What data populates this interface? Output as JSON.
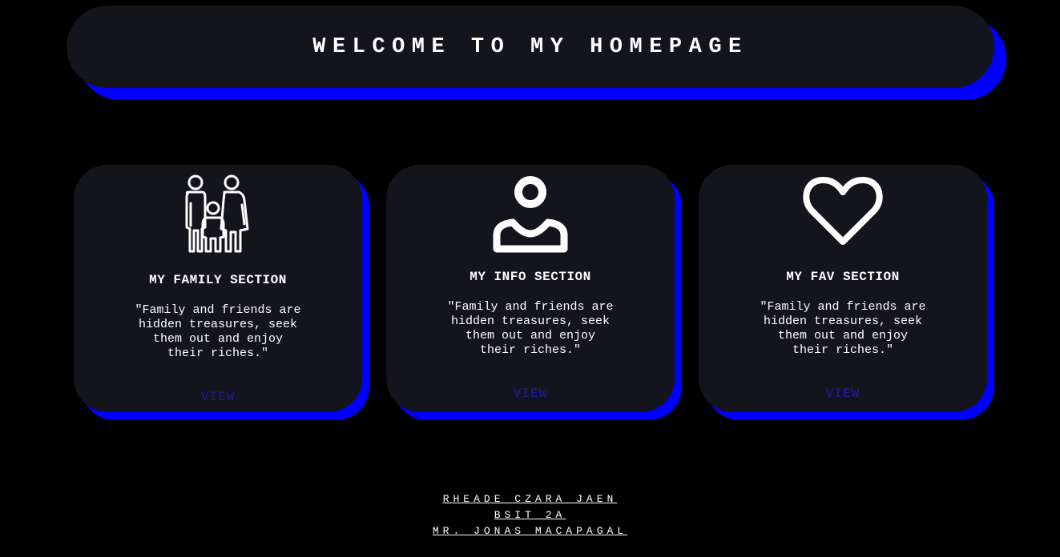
{
  "header": {
    "title": "WELCOME TO MY HOMEPAGE"
  },
  "cards": [
    {
      "icon": "family-icon",
      "title": "MY FAMILY SECTION",
      "quote": "\"Family and friends are hidden treasures, seek them out and enjoy their riches.\"",
      "link_label": "VIEW"
    },
    {
      "icon": "user-icon",
      "title": "MY INFO SECTION",
      "quote": "\"Family and friends are hidden treasures, seek them out and enjoy their riches.\"",
      "link_label": "VIEW"
    },
    {
      "icon": "heart-icon",
      "title": "MY FAV SECTION",
      "quote": "\"Family and friends are hidden treasures, seek them out and enjoy their riches.\"",
      "link_label": "VIEW"
    }
  ],
  "footer": {
    "name": "RHEADE CZARA JAEN",
    "section": "BSIT 2A",
    "instructor": "MR. JONAS MACAPAGAL"
  },
  "colors": {
    "background": "#000000",
    "panel": "#13141c",
    "accent_shadow": "#0000ff",
    "link": "#1c1ca8",
    "text": "#ffffff"
  }
}
